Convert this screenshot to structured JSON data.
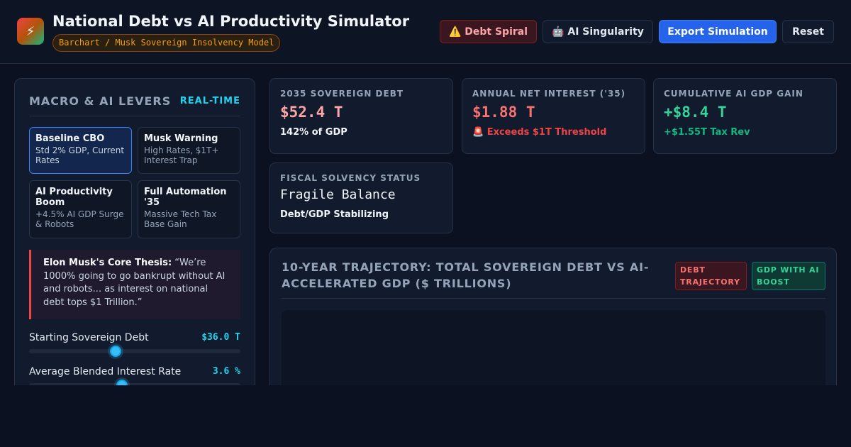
{
  "header": {
    "logo_icon": "⚡",
    "title": "National Debt vs AI Productivity Simulator",
    "subtitle": "Barchart / Musk Sovereign Insolvency Model",
    "buttons": {
      "debt_spiral": "⚠️ Debt Spiral",
      "ai_singularity": "🤖 AI Singularity",
      "export": "Export Simulation",
      "reset": "Reset"
    }
  },
  "levers": {
    "title": "MACRO & AI LEVERS",
    "tag": "REAL-TIME",
    "presets": [
      {
        "name": "Baseline CBO",
        "desc": "Std 2% GDP, Current Rates",
        "active": true
      },
      {
        "name": "Musk Warning",
        "desc": "High Rates, $1T+ Interest Trap",
        "active": false
      },
      {
        "name": "AI Productivity Boom",
        "desc": "+4.5% AI GDP Surge & Robots",
        "active": false
      },
      {
        "name": "Full Automation '35",
        "desc": "Massive Tech Tax Base Gain",
        "active": false
      }
    ],
    "quote": {
      "author": "Elon Musk's Core Thesis:",
      "text": " “We’re 1000% going to go bankrupt without AI and robots... as interest on national debt tops $1 Trillion.”"
    },
    "sliders": [
      {
        "label": "Starting Sovereign Debt",
        "value": "$36.0 T",
        "fraction": 0.41
      },
      {
        "label": "Average Blended Interest Rate",
        "value": "3.6 %",
        "fraction": 0.44
      }
    ]
  },
  "stats": {
    "sovereign_debt": {
      "label": "2035 SOVEREIGN DEBT",
      "value": "$52.4 T",
      "sub": "142% of GDP",
      "value_color": "#fca5a5",
      "sub_color": "#f1f5f9"
    },
    "net_interest": {
      "label": "ANNUAL NET INTEREST ('35)",
      "value": "$1.88 T",
      "sub": "🚨 Exceeds $1T Threshold",
      "value_color": "#f87171",
      "sub_color": "#ef4444"
    },
    "ai_gdp_gain": {
      "label": "CUMULATIVE AI GDP GAIN",
      "value": "+$8.4 T",
      "sub": "+$1.55T Tax Rev",
      "value_color": "#34d399",
      "sub_color": "#10b981"
    },
    "solvency": {
      "label": "FISCAL SOLVENCY STATUS",
      "value": "Fragile Balance",
      "sub": "Debt/GDP Stabilizing",
      "value_color": "#f1f5f9",
      "sub_color": "#f1f5f9"
    }
  },
  "chart": {
    "title": "10-YEAR TRAJECTORY: TOTAL SOVEREIGN DEBT VS AI-ACCELERATED GDP ($ TRILLIONS)",
    "legend_debt": "DEBT TRAJECTORY",
    "legend_gdp": "GDP WITH AI BOOST"
  }
}
